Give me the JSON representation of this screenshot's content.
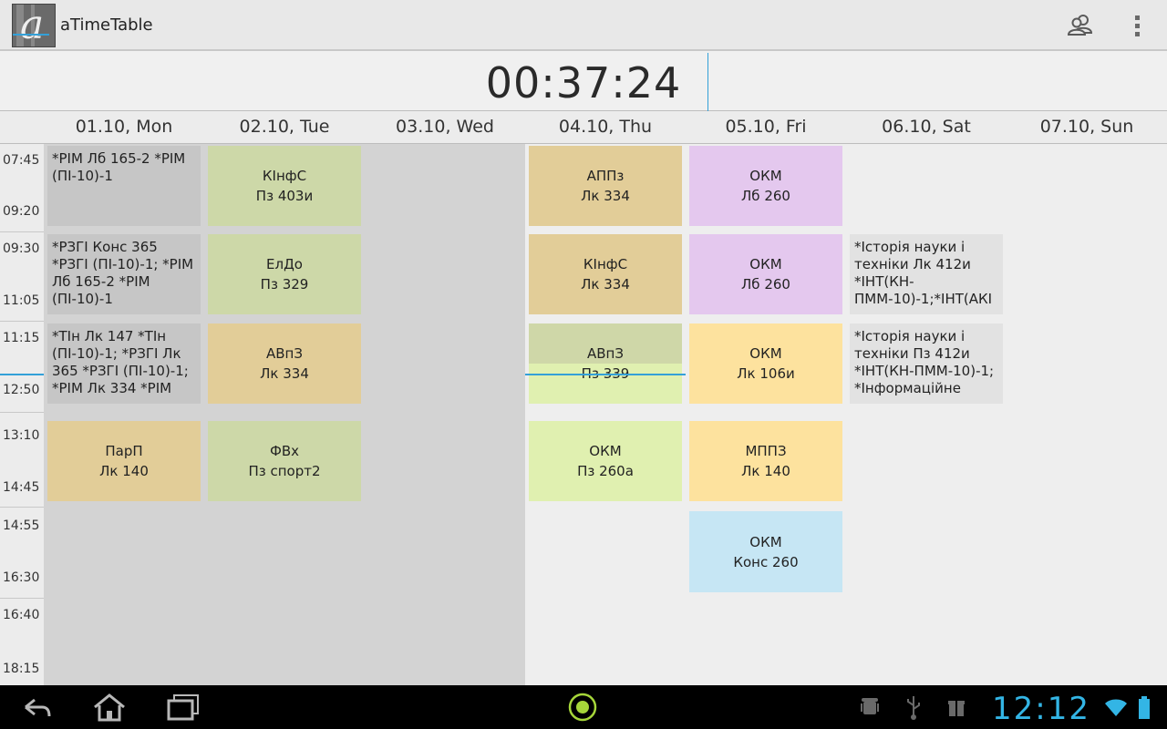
{
  "app": {
    "title": "aTimeTable"
  },
  "timer": {
    "value": "00:37:24"
  },
  "days": [
    {
      "label": "01.10, Mon"
    },
    {
      "label": "02.10, Tue"
    },
    {
      "label": "03.10, Wed"
    },
    {
      "label": "04.10, Thu"
    },
    {
      "label": "05.10, Fri"
    },
    {
      "label": "06.10, Sat"
    },
    {
      "label": "07.10, Sun"
    }
  ],
  "periods": [
    {
      "start": "07:45",
      "end": "09:20"
    },
    {
      "start": "09:30",
      "end": "11:05"
    },
    {
      "start": "11:15",
      "end": "12:50"
    },
    {
      "start": "13:10",
      "end": "14:45"
    },
    {
      "start": "14:55",
      "end": "16:30"
    },
    {
      "start": "16:40",
      "end": "18:15"
    }
  ],
  "lessons": {
    "mon": [
      {
        "text": "*РІМ Лб 165-2 *РІМ (ПІ-10)-1"
      },
      {
        "text": "*РЗГІ Конс 365 *РЗГІ (ПІ-10)-1; *РІМ Лб 165-2 *РІМ (ПІ-10)-1"
      },
      {
        "text": "*ТІн Лк 147 *ТІн (ПІ-10)-1; *РЗГІ Лк 365 *РЗГІ (ПІ-10)-1; *РІМ Лк 334 *РІМ"
      },
      {
        "title": "ПарП",
        "room": "Лк 140"
      }
    ],
    "tue": [
      {
        "title": "КІнфС",
        "room": "Пз 403и"
      },
      {
        "title": "ЕлДо",
        "room": "Пз 329"
      },
      {
        "title": "АВпЗ",
        "room": "Лк 334"
      },
      {
        "title": "ФВх",
        "room": "Пз спорт2"
      }
    ],
    "thu": [
      {
        "title": "АППз",
        "room": "Лк 334"
      },
      {
        "title": "КІнфС",
        "room": "Лк 334"
      },
      {
        "title": "АВпЗ",
        "room": "Пз 339"
      },
      {
        "title": "ОКМ",
        "room": "Пз 260а"
      }
    ],
    "fri": [
      {
        "title": "ОКМ",
        "room": "Лб 260"
      },
      {
        "title": "ОКМ",
        "room": "Лб 260"
      },
      {
        "title": "ОКМ",
        "room": "Лк 106и"
      },
      {
        "title": "МППЗ",
        "room": "Лк 140"
      },
      {
        "title": "ОКМ",
        "room": "Конс 260"
      }
    ],
    "sat": [
      {
        "text": "*Історія науки і техніки Лк 412и *ІНТ(КН-ПММ-10)-1;*ІНТ(АКІ"
      },
      {
        "text": "*Історія науки і техніки Пз 412и *ІНТ(КН-ПММ-10)-1; *Інформаційне"
      }
    ]
  },
  "colors": {
    "accent": "#33b5e5",
    "past_shade": "#d3d3d3",
    "gray": "#c6c6c6",
    "green": "#cdd8a8",
    "tan": "#e2cd98",
    "violet": "#e4c8ee",
    "yellow": "#fde29e",
    "lime": "#e0f0b0",
    "blue": "#c6e6f4"
  },
  "icons": {
    "actionbar": [
      "people-icon",
      "overflow-menu-icon"
    ],
    "nav": [
      "back-icon",
      "home-icon",
      "recent-apps-icon",
      "camera-icon"
    ],
    "status": [
      "android-debug-icon",
      "usb-icon",
      "gift-icon",
      "wifi-icon",
      "battery-icon"
    ]
  },
  "statusbar": {
    "time": "12:12"
  }
}
